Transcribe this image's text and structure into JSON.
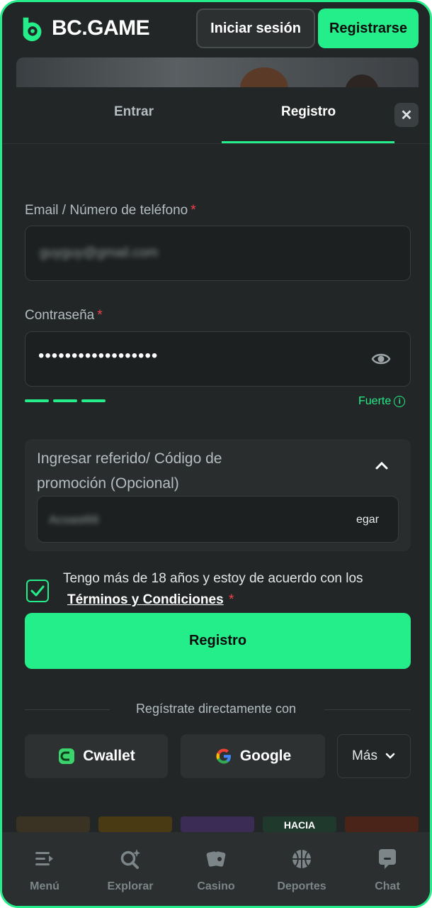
{
  "header": {
    "logo_text": "BC.GAME",
    "login_label": "Iniciar sesión",
    "register_label": "Registrarse"
  },
  "modal": {
    "tabs": [
      {
        "label": "Entrar",
        "active": false
      },
      {
        "label": "Registro",
        "active": true
      }
    ],
    "close_icon": "close-icon",
    "email": {
      "label": "Email / Número de teléfono",
      "required_mark": "*",
      "value": "guyguy@gmail.com"
    },
    "password": {
      "label": "Contraseña",
      "required_mark": "*",
      "value": "••••••••••••••••••",
      "strength_label": "Fuerte",
      "strength_segments": 3
    },
    "promo": {
      "title": "Ingresar referido/ Código de promoción (Opcional)",
      "value": "Acoast66",
      "paste_label": "egar",
      "expanded": true
    },
    "terms": {
      "checked": true,
      "text": "Tengo más de 18 años y estoy de acuerdo con los",
      "link": "Términos y Condiciones",
      "required_mark": "*"
    },
    "submit_label": "Registro",
    "social_divider": "Regístrate directamente con",
    "social": [
      {
        "label": "Cwallet",
        "icon": "cwallet-icon"
      },
      {
        "label": "Google",
        "icon": "google-icon"
      },
      {
        "label": "Más",
        "icon": "chevron-down-icon"
      }
    ],
    "peek_text": "HACIA"
  },
  "bottom_nav": [
    {
      "label": "Menú",
      "icon": "menu-icon"
    },
    {
      "label": "Explorar",
      "icon": "search-sparkle-icon"
    },
    {
      "label": "Casino",
      "icon": "cards-icon"
    },
    {
      "label": "Deportes",
      "icon": "basketball-icon"
    },
    {
      "label": "Chat",
      "icon": "chat-icon"
    }
  ],
  "colors": {
    "accent": "#24ee89",
    "background": "#232626",
    "required": "#f0424d"
  }
}
